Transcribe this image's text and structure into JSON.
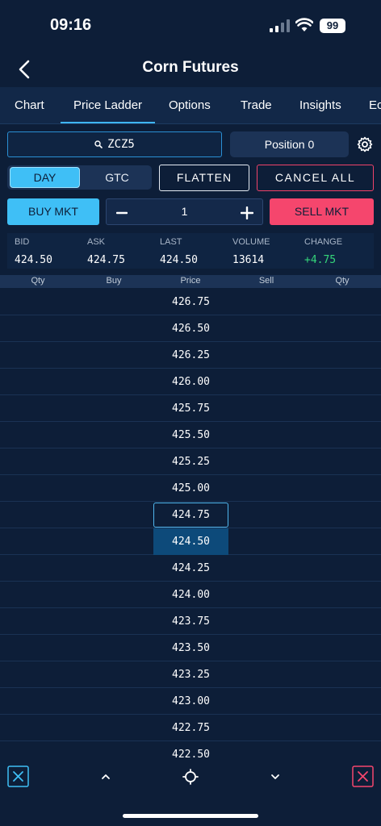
{
  "status": {
    "time": "09:16",
    "battery": "99",
    "signal_icon": "cellular-signal-icon",
    "wifi_icon": "wifi-icon"
  },
  "nav": {
    "title": "Corn Futures",
    "back_icon": "chevron-left-icon"
  },
  "tabs": [
    {
      "label": "Chart",
      "active": false
    },
    {
      "label": "Price Ladder",
      "active": true
    },
    {
      "label": "Options",
      "active": false
    },
    {
      "label": "Trade",
      "active": false
    },
    {
      "label": "Insights",
      "active": false
    },
    {
      "label": "Ec",
      "active": false
    }
  ],
  "controls": {
    "symbol": "ZCZ5",
    "position": "Position 0",
    "settings_icon": "gear-icon",
    "tif_day": "DAY",
    "tif_gtc": "GTC",
    "tif_selected": "DAY",
    "flatten": "FLATTEN",
    "cancel_all": "CANCEL ALL",
    "buy_mkt": "BUY MKT",
    "sell_mkt": "SELL MKT",
    "quantity": "1"
  },
  "quote": {
    "bid_label": "BID",
    "bid": "424.50",
    "ask_label": "ASK",
    "ask": "424.75",
    "last_label": "LAST",
    "last": "424.50",
    "volume_label": "VOLUME",
    "volume": "13614",
    "change_label": "CHANGE",
    "change": "+4.75",
    "change_color": "#35d67a"
  },
  "ladder": {
    "headers": [
      "Qty",
      "Buy",
      "Price",
      "Sell",
      "Qty"
    ],
    "prices": [
      "426.75",
      "426.50",
      "426.25",
      "426.00",
      "425.75",
      "425.50",
      "425.25",
      "425.00",
      "424.75",
      "424.50",
      "424.25",
      "424.00",
      "423.75",
      "423.50",
      "423.25",
      "423.00",
      "422.75",
      "422.50"
    ],
    "outlined_price": "424.75",
    "highlighted_price": "424.50"
  },
  "bottom": {
    "icons": [
      "close-box-icon",
      "chevron-up-icon",
      "crosshair-icon",
      "chevron-down-icon",
      "close-box-red-icon"
    ]
  },
  "colors": {
    "background": "#0d1e38",
    "accent_blue": "#3fbff6",
    "accent_red": "#f5466d",
    "positive_green": "#35d67a"
  }
}
